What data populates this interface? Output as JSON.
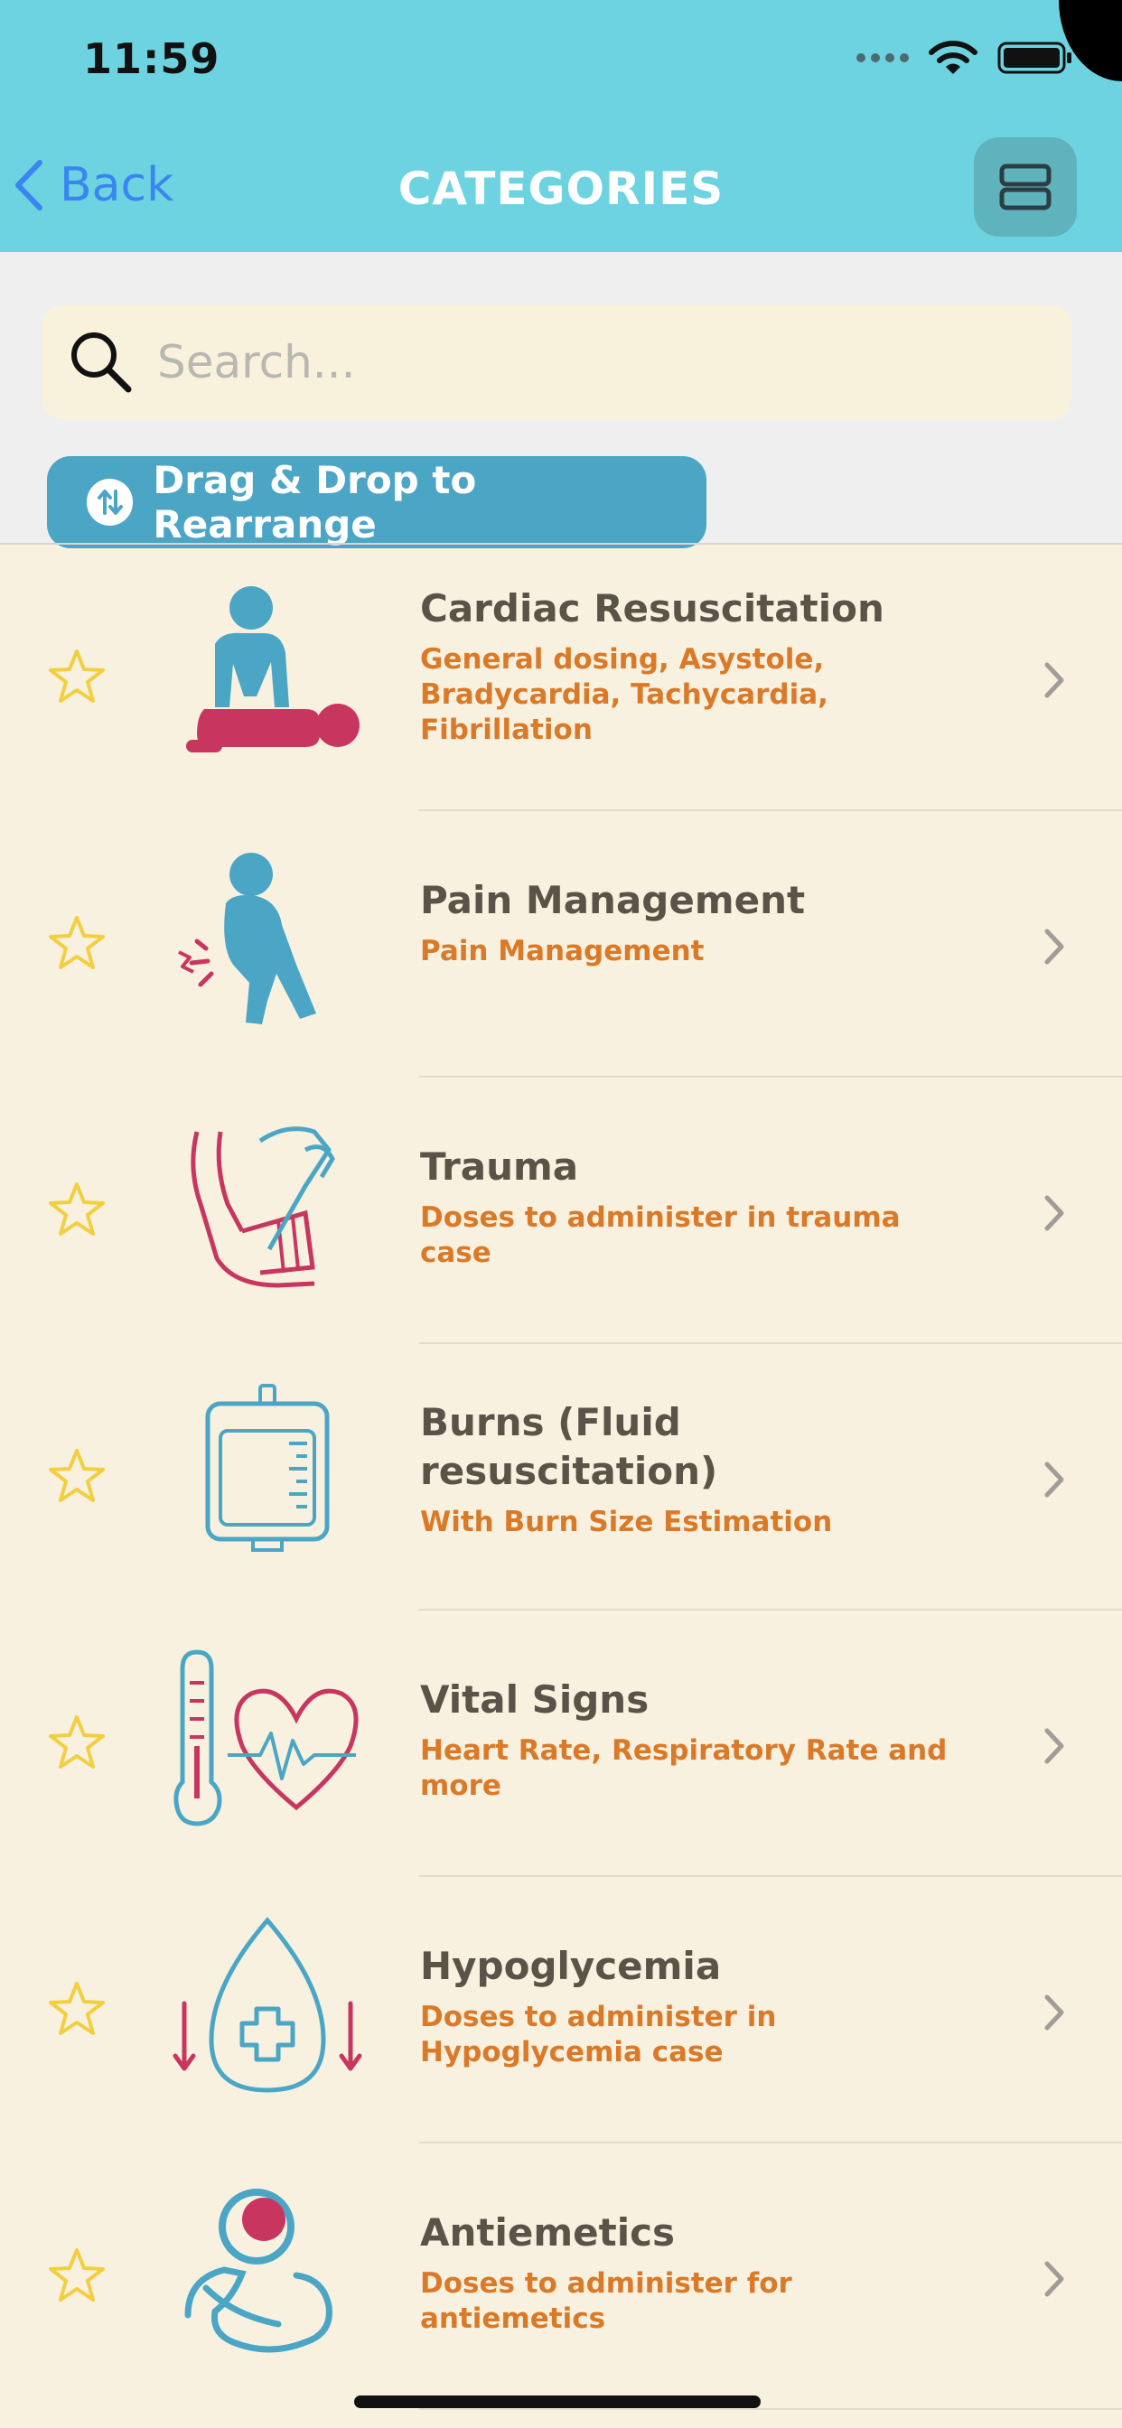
{
  "status": {
    "time": "11:59"
  },
  "nav": {
    "back_label": "Back",
    "title": "CATEGORIES"
  },
  "search": {
    "placeholder": "Search..."
  },
  "drag_drop": {
    "label": "Drag & Drop to Rearrange"
  },
  "categories": [
    {
      "title": "Cardiac Resuscitation",
      "subtitle": "General dosing, Asystole, Bradycardia, Tachycardia, Fibrillation",
      "icon": "cpr-icon"
    },
    {
      "title": "Pain Management",
      "subtitle": "Pain Management",
      "icon": "pain-person-icon"
    },
    {
      "title": "Trauma",
      "subtitle": "Doses to administer in trauma case",
      "icon": "bandaged-leg-icon"
    },
    {
      "title": "Burns (Fluid resuscitation)",
      "subtitle": "With Burn Size Estimation",
      "icon": "iv-bag-icon"
    },
    {
      "title": "Vital Signs",
      "subtitle": "Heart Rate, Respiratory Rate and more",
      "icon": "thermometer-heart-icon"
    },
    {
      "title": "Hypoglycemia",
      "subtitle": "Doses to administer in Hypoglycemia case",
      "icon": "glucose-drop-icon"
    },
    {
      "title": "Antiemetics",
      "subtitle": "Doses to administer for antiemetics",
      "icon": "nausea-person-icon"
    }
  ],
  "colors": {
    "header": "#6dd3e0",
    "accent_blue": "#4ba6c6",
    "subtitle_orange": "#da7a28",
    "icon_pink": "#c8365f",
    "star": "#f3cf3f"
  }
}
